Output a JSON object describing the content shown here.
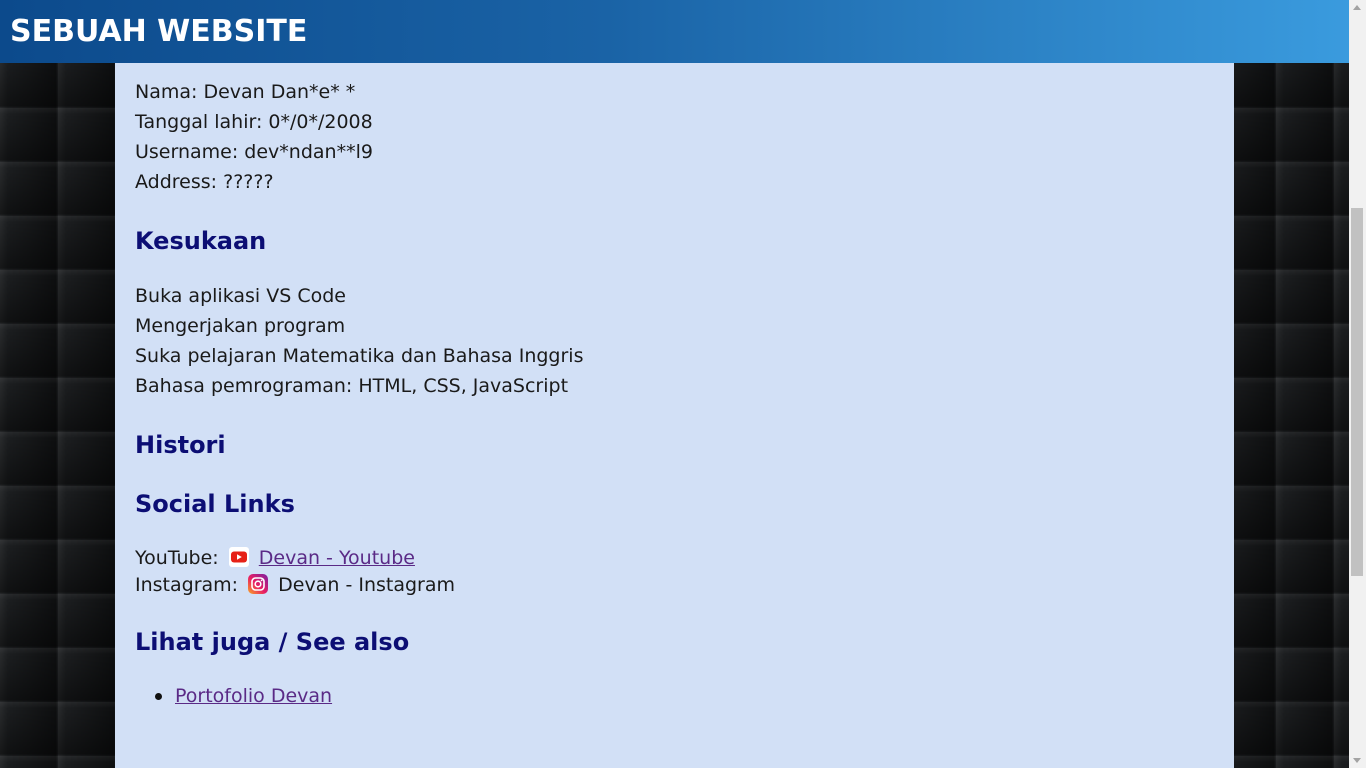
{
  "header": {
    "title": "SEBUAH WEBSITE"
  },
  "profile": {
    "name": "Nama: Devan Dan*e* *",
    "birth": "Tanggal lahir: 0*/0*/2008",
    "username": "Username: dev*ndan**l9",
    "address": "Address: ?????"
  },
  "kesukaan": {
    "heading": "Kesukaan",
    "items": [
      "Buka aplikasi VS Code",
      "Mengerjakan program",
      "Suka pelajaran Matematika dan Bahasa Inggris",
      "Bahasa pemrograman: HTML, CSS, JavaScript"
    ]
  },
  "histori": {
    "heading": "Histori"
  },
  "social": {
    "heading": "Social Links",
    "youtube_label": "YouTube:",
    "youtube_link": "Devan - Youtube",
    "instagram_label": "Instagram:",
    "instagram_text": "Devan - Instagram"
  },
  "see_also": {
    "heading": "Lihat juga / See also",
    "items": [
      "Portofolio Devan"
    ]
  },
  "colors": {
    "header_gradient_start": "#0c4a8c",
    "header_gradient_end": "#3a9bde",
    "content_bg": "#d2e0f6",
    "heading": "#0c0e74",
    "link": "#5a2a86"
  },
  "icons": {
    "youtube": "youtube-icon",
    "instagram": "instagram-icon"
  }
}
